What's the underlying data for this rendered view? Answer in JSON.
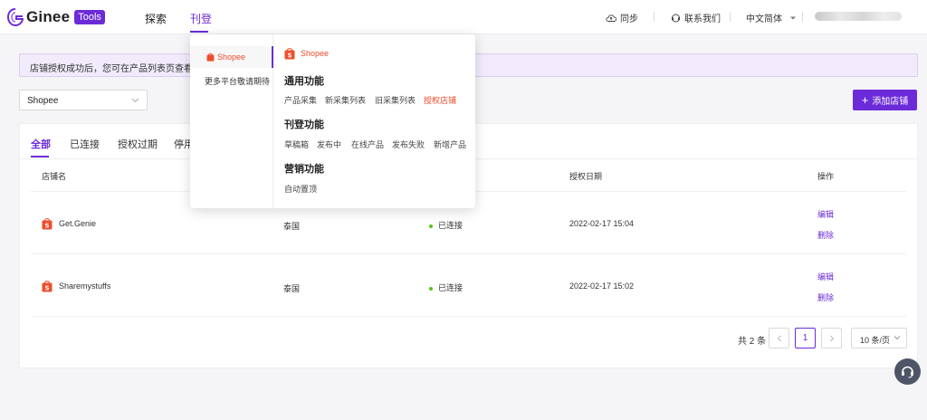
{
  "brand": {
    "name": "Ginee",
    "badge": "Tools"
  },
  "nav": {
    "explore": "探索",
    "listing": "刊登"
  },
  "header_right": {
    "sync": "同步",
    "contact": "联系我们",
    "language": "中文简体"
  },
  "banner": {
    "text": "店铺授权成功后，您可在产品列表页查看同步进"
  },
  "shop_select": {
    "value": "Shopee"
  },
  "add_shop_label": "添加店铺",
  "tabs": [
    "全部",
    "已连接",
    "授权过期",
    "停用"
  ],
  "table": {
    "headers": {
      "shop_name": "店铺名",
      "auth_date": "授权日期",
      "actions": "操作"
    },
    "rows": [
      {
        "name": "Get.Genie",
        "country": "泰国",
        "status": "已连接",
        "date": "2022-02-17 15:04",
        "edit": "编辑",
        "delete": "删除"
      },
      {
        "name": "Sharemystuffs",
        "country": "泰国",
        "status": "已连接",
        "date": "2022-02-17 15:02",
        "edit": "编辑",
        "delete": "删除"
      }
    ]
  },
  "pager": {
    "total": "共 2 条",
    "current": "1",
    "size": "10 条/页"
  },
  "menu": {
    "left": {
      "selected": "Shopee",
      "more": "更多平台敬请期待"
    },
    "right": {
      "platform": "Shopee",
      "sections": [
        {
          "title": "通用功能",
          "items": [
            "产品采集",
            "新采集列表",
            "旧采集列表",
            "授权店铺"
          ]
        },
        {
          "title": "刊登功能",
          "items": [
            "草稿箱",
            "发布中",
            "在线产品",
            "发布失败",
            "新增产品"
          ]
        },
        {
          "title": "营销功能",
          "items": [
            "自动置顶"
          ]
        }
      ],
      "highlight": "授权店铺"
    }
  },
  "colors": {
    "accent": "#6c2bd9",
    "shopee": "#ee4d2d",
    "online": "#52c41a"
  }
}
